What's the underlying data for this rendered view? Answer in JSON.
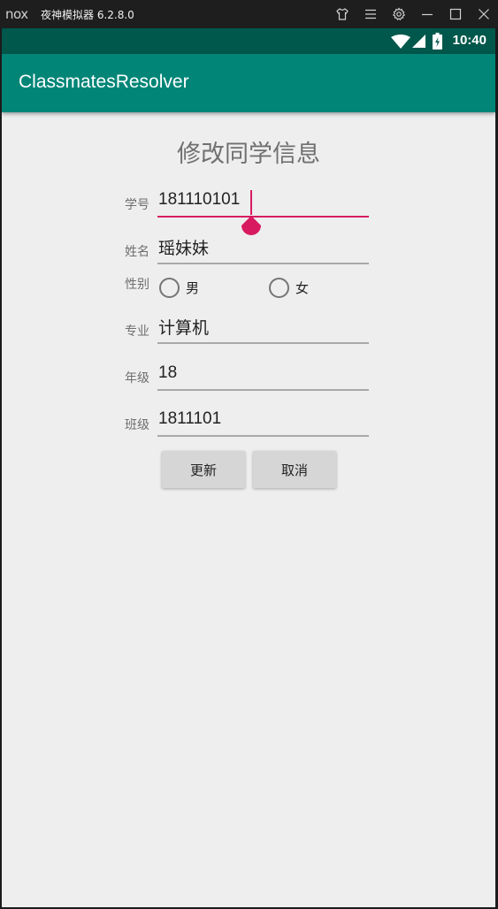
{
  "emulator": {
    "title": "夜神模拟器 6.2.8.0",
    "logo_icon": "nox-logo-icon"
  },
  "status_bar": {
    "time": "10:40",
    "icons": [
      "wifi-icon",
      "cellular-signal-icon",
      "battery-charging-icon"
    ]
  },
  "app_bar": {
    "title": "ClassmatesResolver"
  },
  "form": {
    "heading": "修改同学信息",
    "student_id": {
      "label": "学号",
      "value": "181110101"
    },
    "name": {
      "label": "姓名",
      "value": "瑶妹妹"
    },
    "gender": {
      "label": "性别",
      "options": [
        "男",
        "女"
      ],
      "selected": null
    },
    "major": {
      "label": "专业",
      "value": "计算机"
    },
    "grade": {
      "label": "年级",
      "value": "18"
    },
    "class_no": {
      "label": "班级",
      "value": "1811101"
    },
    "update_button": "更新",
    "cancel_button": "取消"
  },
  "colors": {
    "primary": "#008577",
    "primary_dark": "#00574b",
    "accent": "#d81b60",
    "background": "#eeeeee"
  }
}
